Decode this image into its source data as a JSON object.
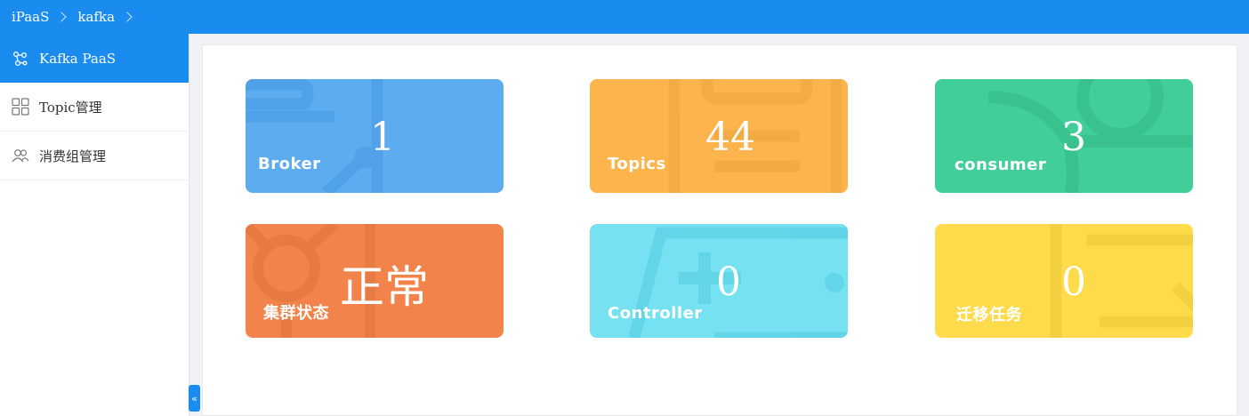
{
  "breadcrumb": {
    "items": [
      "iPaaS",
      "kafka"
    ]
  },
  "sidebar": {
    "items": [
      {
        "label": "Kafka PaaS",
        "icon": "cluster-icon",
        "active": true
      },
      {
        "label": "Topic管理",
        "icon": "grid-icon",
        "active": false
      },
      {
        "label": "消费组管理",
        "icon": "users-icon",
        "active": false
      }
    ],
    "collapse_label": "«"
  },
  "cards": [
    {
      "label": "Broker",
      "value": "1",
      "color": "#5eacf0",
      "icon": "broker-icon"
    },
    {
      "label": "Topics",
      "value": "44",
      "color": "#fdb44c",
      "icon": "topics-icon"
    },
    {
      "label": "consumer",
      "value": "3",
      "color": "#41ce99",
      "icon": "consumer-icon"
    },
    {
      "label": "集群状态",
      "value": "正常",
      "color": "#f2834a",
      "icon": "status-icon"
    },
    {
      "label": "Controller",
      "value": "0",
      "color": "#76e2f1",
      "icon": "controller-icon"
    },
    {
      "label": "迁移任务",
      "value": "0",
      "color": "#fddb4b",
      "icon": "migration-icon"
    }
  ]
}
